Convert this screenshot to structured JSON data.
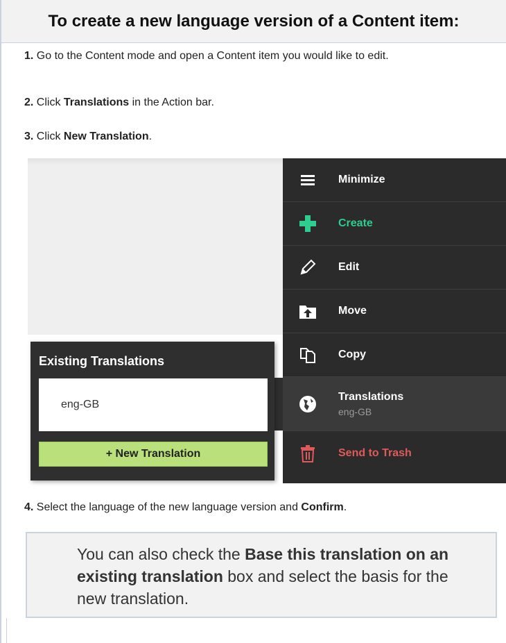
{
  "heading": "To create a new language version of a Content item:",
  "steps": {
    "s1": {
      "num": "1.",
      "text": " Go to the Content mode and open a Content item you would like to edit."
    },
    "s2": {
      "num": "2.",
      "pre": " Click ",
      "bold": "Translations",
      "post": " in the Action bar."
    },
    "s3": {
      "num": "3.",
      "pre": " Click ",
      "bold": "New Translation",
      "post": "."
    },
    "s4": {
      "num": "4.",
      "pre": " Select the language of the new language version and ",
      "bold": "Confirm",
      "post": "."
    }
  },
  "action_bar": {
    "minimize": "Minimize",
    "create": "Create",
    "edit": "Edit",
    "move": "Move",
    "copy": "Copy",
    "translations": "Translations",
    "translations_sub": "eng-GB",
    "trash": "Send to Trash"
  },
  "translations_panel": {
    "title": "Existing Translations",
    "existing": "eng-GB",
    "new_button": "+ New Translation"
  },
  "note": {
    "pre": "You can also check the ",
    "bold": "Base this translation on an existing translation",
    "post": " box and select the basis for the new translation."
  },
  "colors": {
    "create": "#2ecc8f",
    "trash": "#e05a5a",
    "new_button": "#b9e07a",
    "action_bar": "#2b2b2b"
  }
}
